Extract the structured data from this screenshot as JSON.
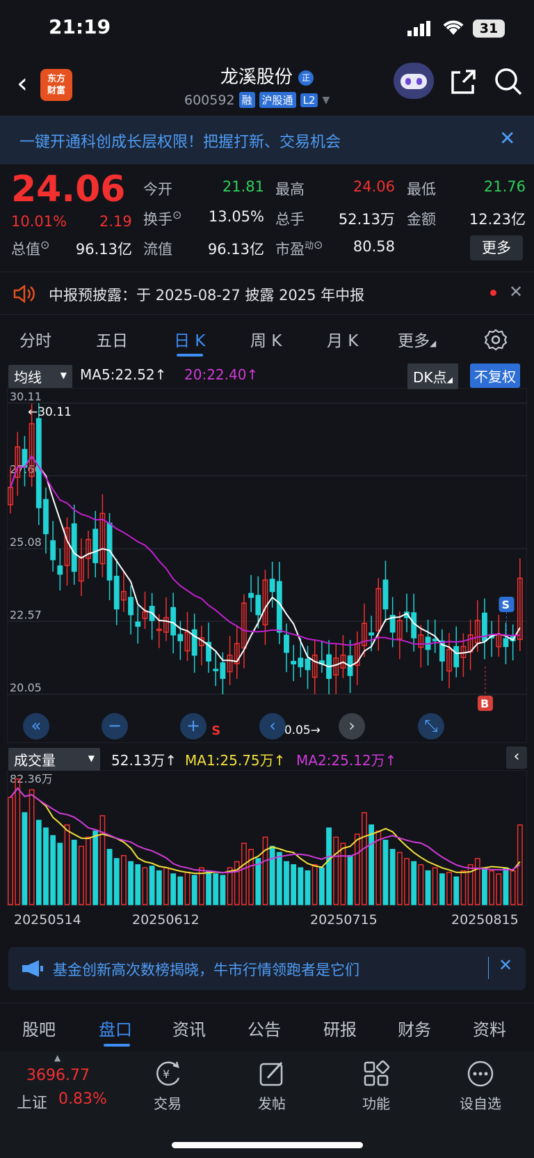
{
  "status": {
    "time": "21:19",
    "battery": "31"
  },
  "header": {
    "logo_line1": "东方",
    "logo_line2": "财富",
    "title": "龙溪股份",
    "title_badge": "正",
    "code": "600592",
    "tags": [
      "融",
      "沪股通",
      "L2"
    ]
  },
  "banner": {
    "text": "一键开通科创成长层权限！把握打新、交易机会"
  },
  "quote": {
    "price": "24.06",
    "pct": "10.01%",
    "change": "2.19",
    "row1": [
      {
        "label": "今开",
        "value": "21.81",
        "color": "green"
      },
      {
        "label": "最高",
        "value": "24.06",
        "color": "red"
      },
      {
        "label": "最低",
        "value": "21.76",
        "color": "green"
      }
    ],
    "row2": [
      {
        "label": "换手",
        "value": "13.05%"
      },
      {
        "label": "总手",
        "value": "52.13万"
      },
      {
        "label": "金额",
        "value": "12.23亿"
      }
    ],
    "row3": [
      {
        "label": "总值",
        "value": "96.13亿"
      },
      {
        "label": "流值",
        "value": "96.13亿"
      },
      {
        "label": "市盈",
        "sup": "动",
        "value": "80.58"
      }
    ],
    "more": "更多"
  },
  "notice": {
    "text": "中报预披露：于 2025-08-27 披露 2025 年中报"
  },
  "tabs": [
    "分时",
    "五日",
    "日 K",
    "周 K",
    "月 K",
    "更多"
  ],
  "active_tab": "日 K",
  "kline_bar": {
    "selector": "均线",
    "ma5": "MA5:22.52↑",
    "ma20": "20:22.40↑",
    "dk": "DK点",
    "fq": "不复权"
  },
  "chart_data": {
    "type": "candlestick",
    "y_ticks": [
      "30.11",
      "27.60",
      "25.08",
      "22.57",
      "20.05"
    ],
    "ylim": [
      20.05,
      30.11
    ],
    "max_label": "←30.11",
    "min_label": "20.05→",
    "x_dates": [
      "20250514",
      "20250612",
      "20250715",
      "20250815"
    ],
    "markers": [
      {
        "text": "S"
      },
      {
        "text": "S"
      },
      {
        "text": "B"
      }
    ],
    "close": [
      27.2,
      28.6,
      27.9,
      29.4,
      26.5,
      25.6,
      24.7,
      24.2,
      25.8,
      24.3,
      24.8,
      25.4,
      24.6,
      26.3,
      24.0,
      23.0,
      23.6,
      22.8,
      22.4,
      22.9,
      22.6,
      22.3,
      22.7,
      22.1,
      21.9,
      22.2,
      21.4,
      22.0,
      21.2,
      20.9,
      20.6,
      21.4,
      21.8,
      23.2,
      23.4,
      22.8,
      24.0,
      23.6,
      22.2,
      21.5,
      21.1,
      21.0,
      20.9,
      21.4,
      21.1,
      20.6,
      21.3,
      21.4,
      20.7,
      21.8,
      22.5,
      22.1,
      23.7,
      23.0,
      22.2,
      22.6,
      22.7,
      22.0,
      22.1,
      21.6,
      21.9,
      21.2,
      21.6,
      21.0,
      21.7,
      22.1,
      22.6,
      21.9,
      22.0,
      22.1,
      21.7,
      21.9,
      24.06
    ],
    "ma_overlay_names": [
      "MA5",
      "MA20"
    ]
  },
  "vol_bar": {
    "selector": "成交量",
    "vol": "52.13万↑",
    "ma1": "MA1:25.75万↑",
    "ma2": "MA2:25.12万↑",
    "max_label": "82.36万"
  },
  "vol_data": {
    "values": [
      70,
      82,
      60,
      75,
      55,
      50,
      45,
      40,
      52,
      42,
      38,
      44,
      48,
      58,
      36,
      30,
      32,
      28,
      26,
      24,
      25,
      22,
      24,
      20,
      18,
      21,
      19,
      24,
      22,
      20,
      19,
      24,
      28,
      40,
      36,
      30,
      44,
      38,
      34,
      28,
      26,
      24,
      22,
      26,
      24,
      50,
      44,
      40,
      32,
      46,
      60,
      52,
      48,
      42,
      36,
      34,
      30,
      28,
      26,
      22,
      24,
      20,
      21,
      18,
      22,
      26,
      30,
      24,
      22,
      20,
      24,
      22,
      52
    ]
  },
  "ad": {
    "text": "基金创新高次数榜揭晓，牛市行情领跑者是它们"
  },
  "bottom_tabs": [
    "股吧",
    "盘口",
    "资讯",
    "公告",
    "研报",
    "财务",
    "资料"
  ],
  "active_bottom_tab": "盘口",
  "footer": {
    "index_value": "3696.77",
    "index_name": "上证",
    "index_pct": "0.83%",
    "items": [
      "交易",
      "发帖",
      "功能",
      "设自选"
    ]
  },
  "colors": {
    "up": "#f23030",
    "down": "#22d3d6",
    "ma5": "#ffffff",
    "ma20": "#c21fd0",
    "vma1": "#f2e03a",
    "vma2": "#d03ad8",
    "accent": "#3d8ef5"
  }
}
